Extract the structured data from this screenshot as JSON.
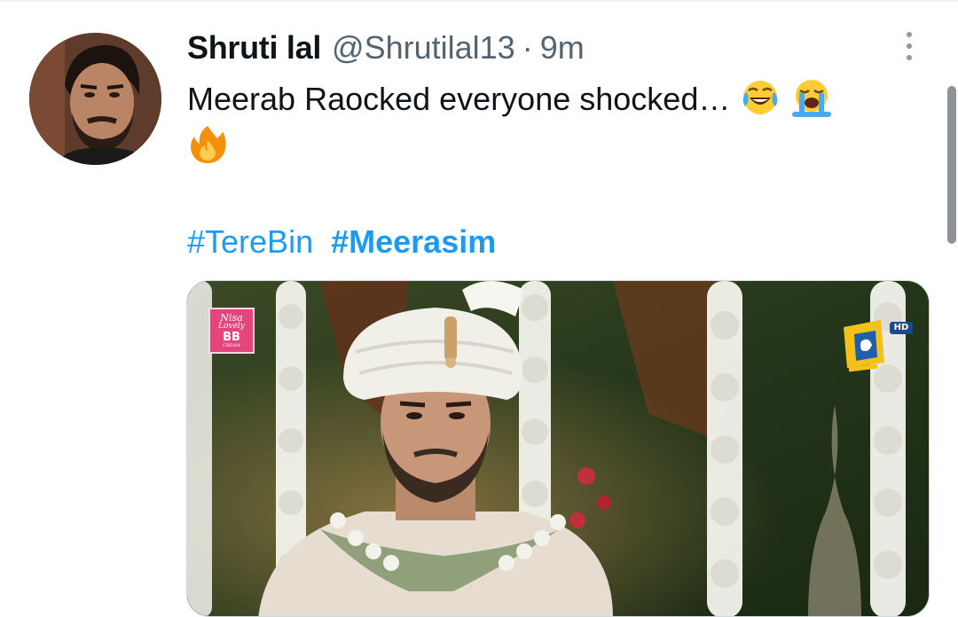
{
  "tweet": {
    "display_name": "Shruti lal",
    "handle": "@Shrutilal13",
    "separator": "·",
    "timestamp": "9m",
    "text": "Meerab Raocked everyone shocked…",
    "inline_emojis": [
      "face-with-tears-of-joy",
      "loudly-crying-face"
    ],
    "second_line_emojis": [
      "fire"
    ],
    "hashtags": [
      "#TereBin",
      "#Meerasim"
    ]
  },
  "media": {
    "watermark_brand": {
      "line1": "Nisa",
      "line2": "Lovely",
      "line3": "BB",
      "line4": "CREAM"
    },
    "channel_logo": "geo-entertainment-logo",
    "hd_label": "HD"
  },
  "icons": {
    "more": "more-vertical-icon"
  },
  "colors": {
    "link": "#1d9bf0",
    "secondary_text": "#536471",
    "primary_text": "#0f1419"
  }
}
